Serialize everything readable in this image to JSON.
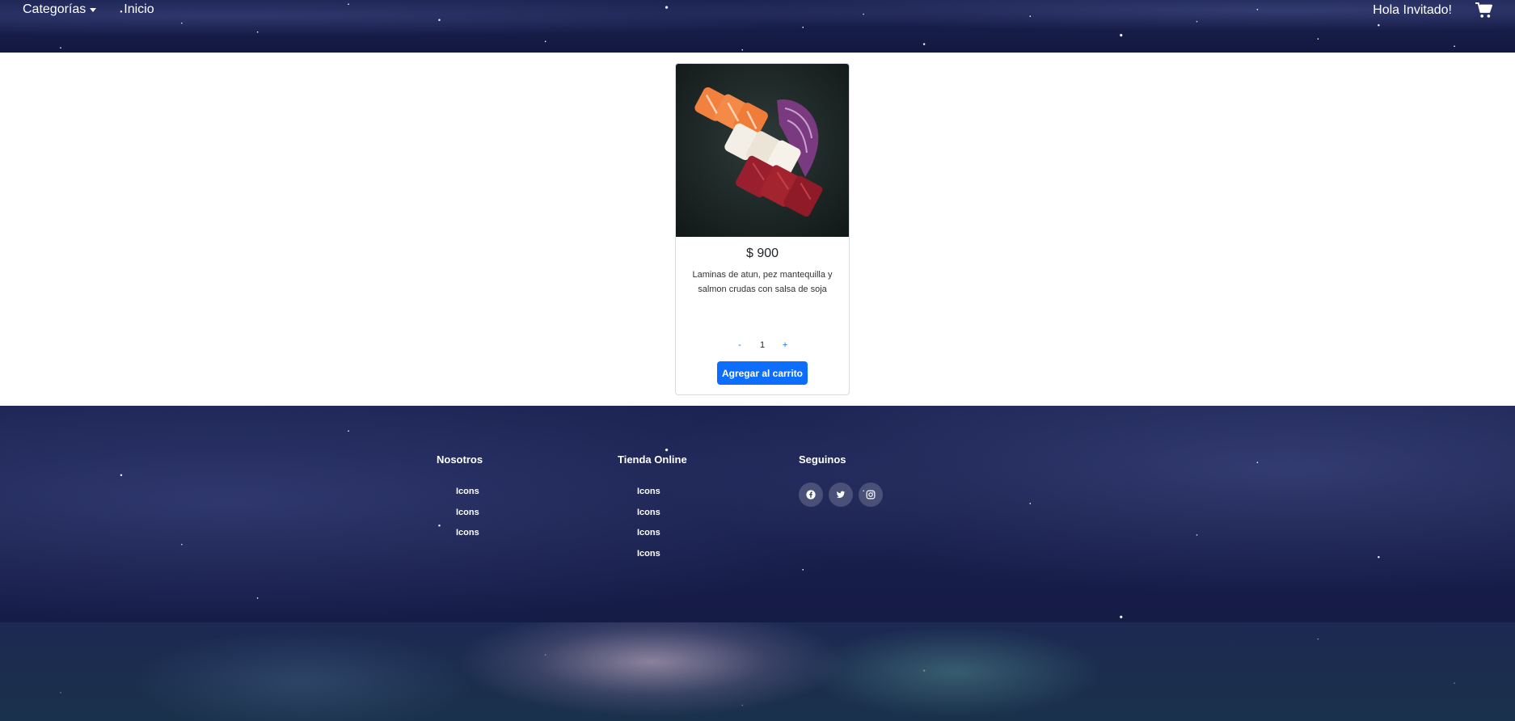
{
  "header": {
    "nav": {
      "categories_label": "Categorías",
      "home_label": "Inicio"
    },
    "greeting": "Hola Invitado!",
    "cart_icon": "shopping-cart-icon"
  },
  "product": {
    "image_alt": "sashimi plate",
    "price": "$ 900",
    "description": "Laminas de atun, pez mantequilla y salmon crudas con salsa de soja",
    "quantity": {
      "decrement_label": "-",
      "value": "1",
      "increment_label": "+"
    },
    "add_to_cart_label": "Agregar al carrito"
  },
  "footer": {
    "columns": [
      {
        "title": "Nosotros",
        "items": [
          "Icons",
          "Icons",
          "Icons"
        ]
      },
      {
        "title": "Tienda Online",
        "items": [
          "Icons",
          "Icons",
          "Icons",
          "Icons"
        ]
      },
      {
        "title": "Seguinos",
        "socials": [
          "facebook-icon",
          "twitter-icon",
          "instagram-icon"
        ]
      }
    ]
  },
  "colors": {
    "primary_button": "#0d6efd",
    "space_background": "#141a44"
  }
}
